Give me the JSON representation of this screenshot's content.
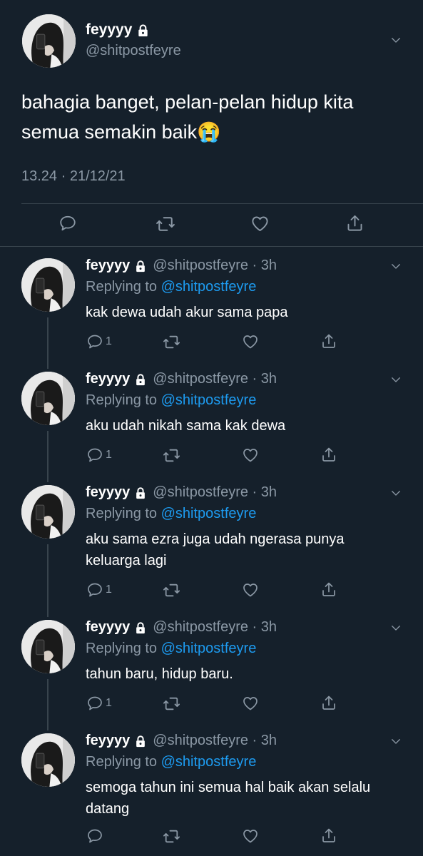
{
  "main": {
    "display_name": "feyyyy",
    "handle": "@shitpostfeyre",
    "text": "bahagia banget, pelan-pelan hidup kita semua semakin baik😭",
    "timestamp": "13.24 · 21/12/21"
  },
  "replies": [
    {
      "name": "feyyyy",
      "handle": "@shitpostfeyre",
      "time": "3h",
      "replying_prefix": "Replying to",
      "replying_to": "@shitpostfeyre",
      "text": "kak dewa udah akur sama papa",
      "reply_count": "1"
    },
    {
      "name": "feyyyy",
      "handle": "@shitpostfeyre",
      "time": "3h",
      "replying_prefix": "Replying to",
      "replying_to": "@shitpostfeyre",
      "text": "aku udah nikah sama kak dewa",
      "reply_count": "1"
    },
    {
      "name": "feyyyy",
      "handle": "@shitpostfeyre",
      "time": "3h",
      "replying_prefix": "Replying to",
      "replying_to": "@shitpostfeyre",
      "text": "aku sama ezra juga udah ngerasa punya keluarga lagi",
      "reply_count": "1"
    },
    {
      "name": "feyyyy",
      "handle": "@shitpostfeyre",
      "time": "3h",
      "replying_prefix": "Replying to",
      "replying_to": "@shitpostfeyre",
      "text": "tahun baru, hidup baru.",
      "reply_count": "1"
    },
    {
      "name": "feyyyy",
      "handle": "@shitpostfeyre",
      "time": "3h",
      "replying_prefix": "Replying to",
      "replying_to": "@shitpostfeyre",
      "text": "semoga tahun ini semua hal baik akan selalu datang",
      "reply_count": ""
    }
  ],
  "icons": {
    "reply": "reply-icon",
    "retweet": "retweet-icon",
    "like": "like-icon",
    "share": "share-icon",
    "lock": "lock-icon",
    "more": "chevron-down-icon"
  },
  "colors": {
    "background": "#15202b",
    "muted": "#8b98a5",
    "link": "#1d9bf0",
    "divider": "#38444d"
  }
}
